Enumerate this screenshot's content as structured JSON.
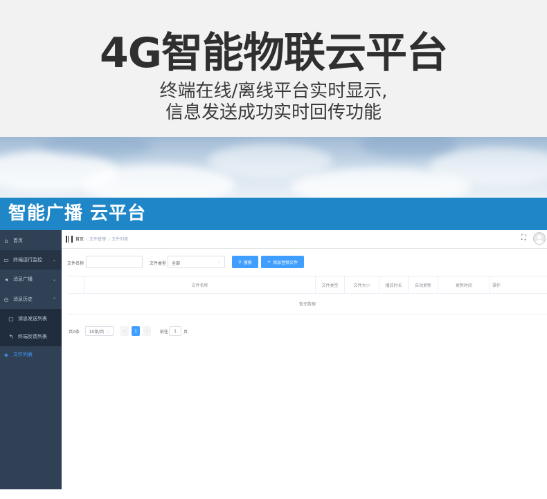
{
  "hero": {
    "title": "4G智能物联云平台",
    "subtitle_line1": "终端在线/离线平台实时显示,",
    "subtitle_line2": "信息发送成功实时回传功能"
  },
  "banner": {
    "title": "智能广播 云平台"
  },
  "sidebar": {
    "items": [
      {
        "icon": "home-icon",
        "label": "首页"
      },
      {
        "icon": "monitor-icon",
        "label": "终端运行监控"
      },
      {
        "icon": "broadcast-icon",
        "label": "消息广播"
      },
      {
        "icon": "clock-icon",
        "label": "消息历史"
      },
      {
        "icon": "message-icon",
        "label": "消息发送列表"
      },
      {
        "icon": "reply-icon",
        "label": "终端反馈列表"
      },
      {
        "icon": "file-icon",
        "label": "文件列表"
      }
    ]
  },
  "topbar": {
    "breadcrumb": [
      "首页",
      "文件管理",
      "文件列表"
    ]
  },
  "filters": {
    "file_name_label": "文件名称",
    "file_name_value": "",
    "file_type_label": "文件类型",
    "file_type_value": "全部",
    "search_button": "搜索",
    "add_button": "添加音频文件"
  },
  "table": {
    "columns": [
      "文件名称",
      "文件类型",
      "文件大小",
      "播放时长",
      "自动更新",
      "更新时间",
      "操作"
    ],
    "empty_text": "暂无数据"
  },
  "pagination": {
    "total": "共0条",
    "page_size": "10条/页",
    "current_page": "1",
    "goto_label": "前往",
    "goto_value": "1",
    "page_unit": "页"
  },
  "colors": {
    "banner": "#1f87c8",
    "sidebar": "#304156",
    "accent": "#409eff"
  }
}
